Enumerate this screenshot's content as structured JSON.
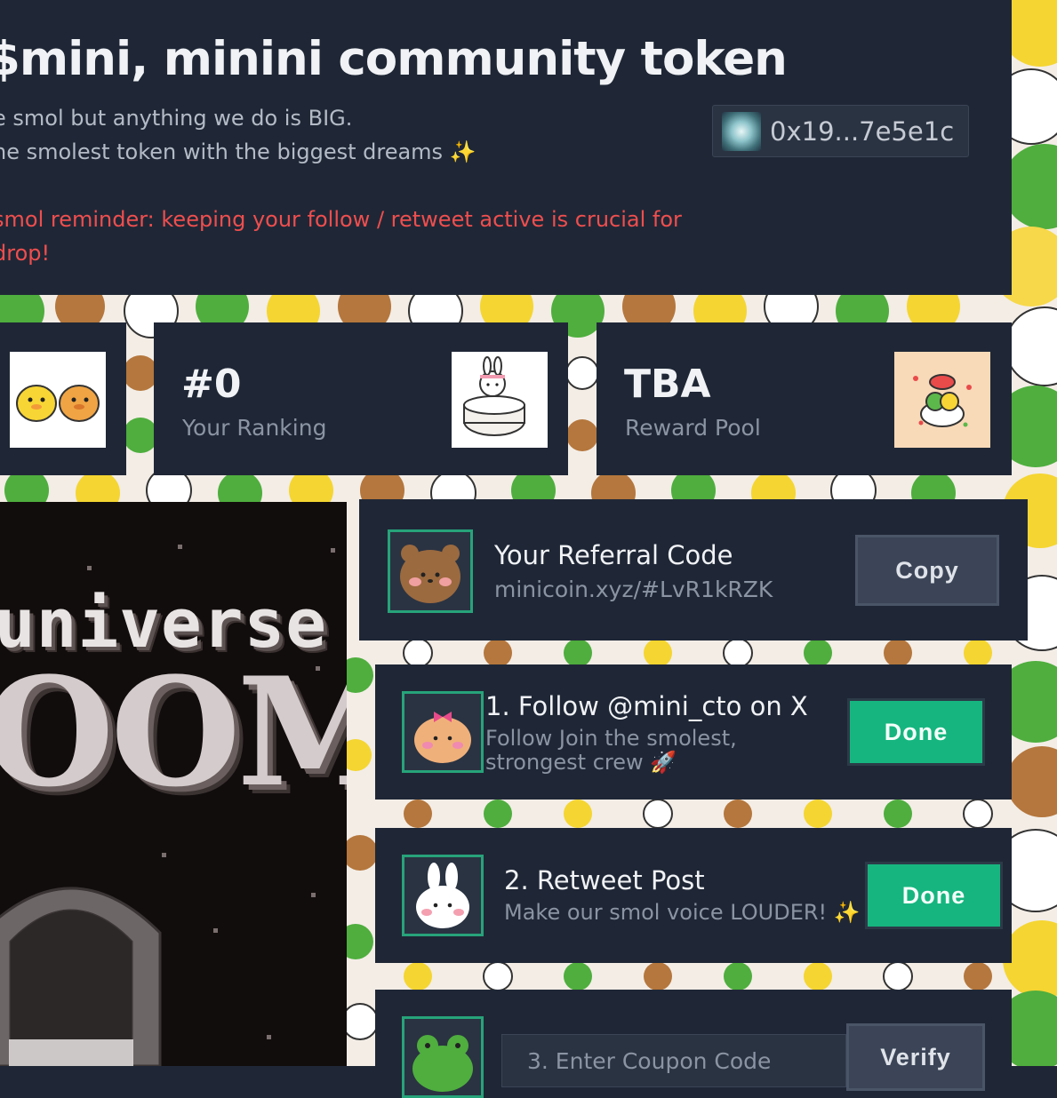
{
  "header": {
    "title": "$mini, minini community token",
    "description_line1": "e smol but anything we do is BIG.",
    "description_line2": "ne smolest token with the biggest dreams ✨",
    "reminder_line1": "smol reminder: keeping your follow / retweet active is crucial for",
    "reminder_line2": "drop!",
    "wallet_address": "0x19...7e5e1c"
  },
  "stats": {
    "ranking_value": "#0",
    "ranking_label": "Your Ranking",
    "pool_value": "TBA",
    "pool_label": "Reward Pool"
  },
  "game": {
    "title_small": "universe",
    "title_large": "OOM"
  },
  "referral": {
    "title": "Your Referral Code",
    "link": "minicoin.xyz/#LvR1kRZK",
    "copy_label": "Copy"
  },
  "tasks": {
    "follow": {
      "title": "1. Follow @mini_cto on X",
      "sub_line1": "Follow Join the smolest,",
      "sub_line2": "strongest crew 🚀",
      "button": "Done"
    },
    "retweet": {
      "title": "2. Retweet Post",
      "sub": "Make our smol voice LOUDER! ✨",
      "button": "Done"
    },
    "coupon": {
      "placeholder": "3. Enter Coupon Code",
      "button": "Verify"
    }
  },
  "colors": {
    "panel": "#1f2736",
    "accent_green": "#16b57f",
    "warning_red": "#ef4e4e"
  },
  "icons": {
    "wallet": "wallet-avatar-icon",
    "referral": "bear-icon",
    "follow": "bow-bear-icon",
    "retweet": "bunny-icon",
    "coupon": "frog-icon"
  }
}
